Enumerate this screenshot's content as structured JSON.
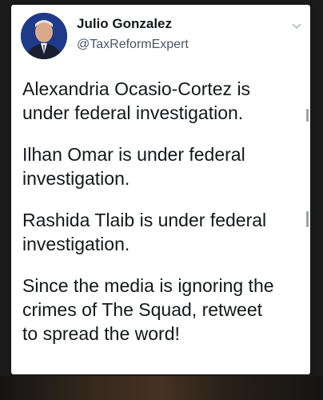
{
  "tweet": {
    "display_name": "Julio Gonzalez",
    "handle": "@TaxReformExpert",
    "paragraphs": [
      {
        "lines": [
          "Alexandria Ocasio-Cortez is",
          "under federal investigation."
        ]
      },
      {
        "lines": [
          "Ilhan Omar is under federal",
          "investigation."
        ]
      },
      {
        "lines": [
          "Rashida Tlaib is under federal",
          "investigation."
        ]
      },
      {
        "lines": [
          "Since the media is ignoring the",
          "crimes of The Squad, retweet",
          "to spread the word!"
        ]
      }
    ]
  },
  "icons": {
    "avatar": "profile-photo",
    "menu": "chevron-down-icon"
  },
  "colors": {
    "card_background": "#ffffff",
    "page_background": "#1b1b1b",
    "text_primary": "#14171a",
    "text_secondary": "#4b5563"
  }
}
